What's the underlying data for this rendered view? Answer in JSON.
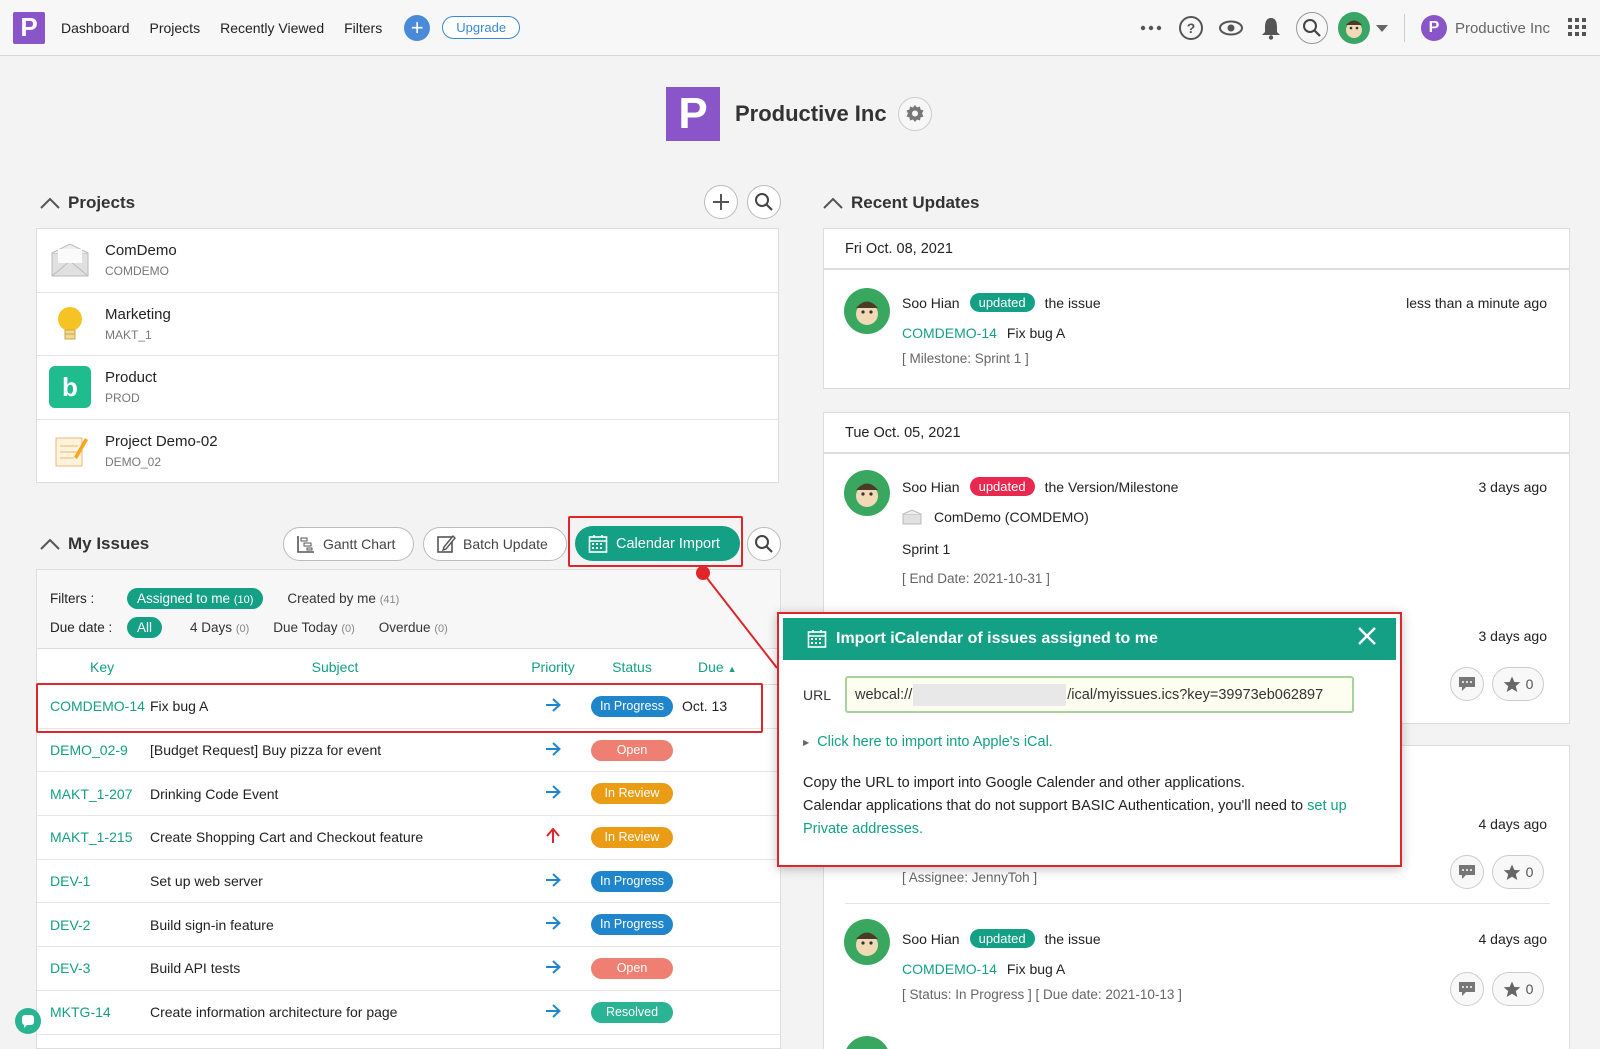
{
  "topbar": {
    "logo_letter": "P",
    "nav": [
      "Dashboard",
      "Projects",
      "Recently Viewed",
      "Filters"
    ],
    "upgrade_label": "Upgrade",
    "org_letter": "P",
    "org_name": "Productive Inc"
  },
  "header": {
    "logo_letter": "P",
    "title": "Productive Inc"
  },
  "projects": {
    "title": "Projects",
    "items": [
      {
        "name": "ComDemo",
        "key": "COMDEMO",
        "icon": "envelope-icon"
      },
      {
        "name": "Marketing",
        "key": "MAKT_1",
        "icon": "lightbulb-icon"
      },
      {
        "name": "Product",
        "key": "PROD",
        "icon": "product-b-icon"
      },
      {
        "name": "Project Demo-02",
        "key": "DEMO_02",
        "icon": "notepad-icon"
      }
    ]
  },
  "my_issues": {
    "title": "My Issues",
    "gantt_label": "Gantt Chart",
    "batch_label": "Batch Update",
    "calendar_label": "Calendar Import",
    "filters_label": "Filters :",
    "assigned_label": "Assigned to me",
    "assigned_count": "(10)",
    "created_label": "Created by me",
    "created_count": "(41)",
    "due_label": "Due date :",
    "due_all": "All",
    "due_4days": "4 Days",
    "due_4days_count": "(0)",
    "due_today": "Due Today",
    "due_today_count": "(0)",
    "overdue": "Overdue",
    "overdue_count": "(0)",
    "columns": {
      "key": "Key",
      "subject": "Subject",
      "priority": "Priority",
      "status": "Status",
      "due": "Due"
    },
    "rows": [
      {
        "key": "COMDEMO-14",
        "subject": "Fix bug A",
        "priority": "normal",
        "status": "In Progress",
        "due": "Oct. 13"
      },
      {
        "key": "DEMO_02-9",
        "subject": "[Budget Request] Buy pizza for event",
        "priority": "normal",
        "status": "Open",
        "due": ""
      },
      {
        "key": "MAKT_1-207",
        "subject": "Drinking Code Event",
        "priority": "normal",
        "status": "In Review",
        "due": ""
      },
      {
        "key": "MAKT_1-215",
        "subject": "Create Shopping Cart and Checkout feature",
        "priority": "high",
        "status": "In Review",
        "due": ""
      },
      {
        "key": "DEV-1",
        "subject": "Set up web server",
        "priority": "normal",
        "status": "In Progress",
        "due": ""
      },
      {
        "key": "DEV-2",
        "subject": "Build sign-in feature",
        "priority": "normal",
        "status": "In Progress",
        "due": ""
      },
      {
        "key": "DEV-3",
        "subject": "Build API tests",
        "priority": "normal",
        "status": "Open",
        "due": ""
      },
      {
        "key": "MKTG-14",
        "subject": "Create information architecture for page",
        "priority": "normal",
        "status": "Resolved",
        "due": ""
      }
    ]
  },
  "recent_updates": {
    "title": "Recent Updates",
    "card1": {
      "date": "Fri Oct. 08, 2021",
      "user": "Soo Hian",
      "tag": "updated",
      "action": "the issue",
      "time": "less than a minute ago",
      "issue_key": "COMDEMO-14",
      "issue_subject": "Fix bug A",
      "meta": "[ Milestone: Sprint 1 ]"
    },
    "card2": {
      "date": "Tue Oct. 05, 2021",
      "user": "Soo Hian",
      "tag": "updated",
      "action": "the Version/Milestone",
      "time": "3 days ago",
      "project": "ComDemo (COMDEMO)",
      "version": "Sprint 1",
      "meta": "[ End Date: 2021-10-31 ]",
      "entry2_time": "3 days ago",
      "entry2_stars": "0"
    },
    "card3": {
      "entry1_time": "4 days ago",
      "entry1_meta": "[ Assignee: JennyToh ]",
      "entry1_stars": "0",
      "user": "Soo Hian",
      "tag": "updated",
      "action": "the issue",
      "time": "4 days ago",
      "issue_key": "COMDEMO-14",
      "issue_subject": "Fix bug A",
      "meta": "[ Status: In Progress ] [ Due date: 2021-10-13 ]",
      "stars": "0"
    }
  },
  "modal": {
    "title": "Import iCalendar of issues assigned to me",
    "url_label": "URL",
    "url_prefix": "webcal://",
    "url_suffix": "/ical/myissues.ics?key=39973eb062897",
    "apple_link": "Click here to import into Apple's iCal.",
    "text1": "Copy the URL to import into Google Calender and other applications.",
    "text2": "Calendar applications that do not support BASIC Authentication, you'll need to",
    "text_link": "set up Private addresses."
  },
  "colors": {
    "accent": "#14a085",
    "brand": "#8a55c9",
    "highlight": "#e0262a"
  }
}
